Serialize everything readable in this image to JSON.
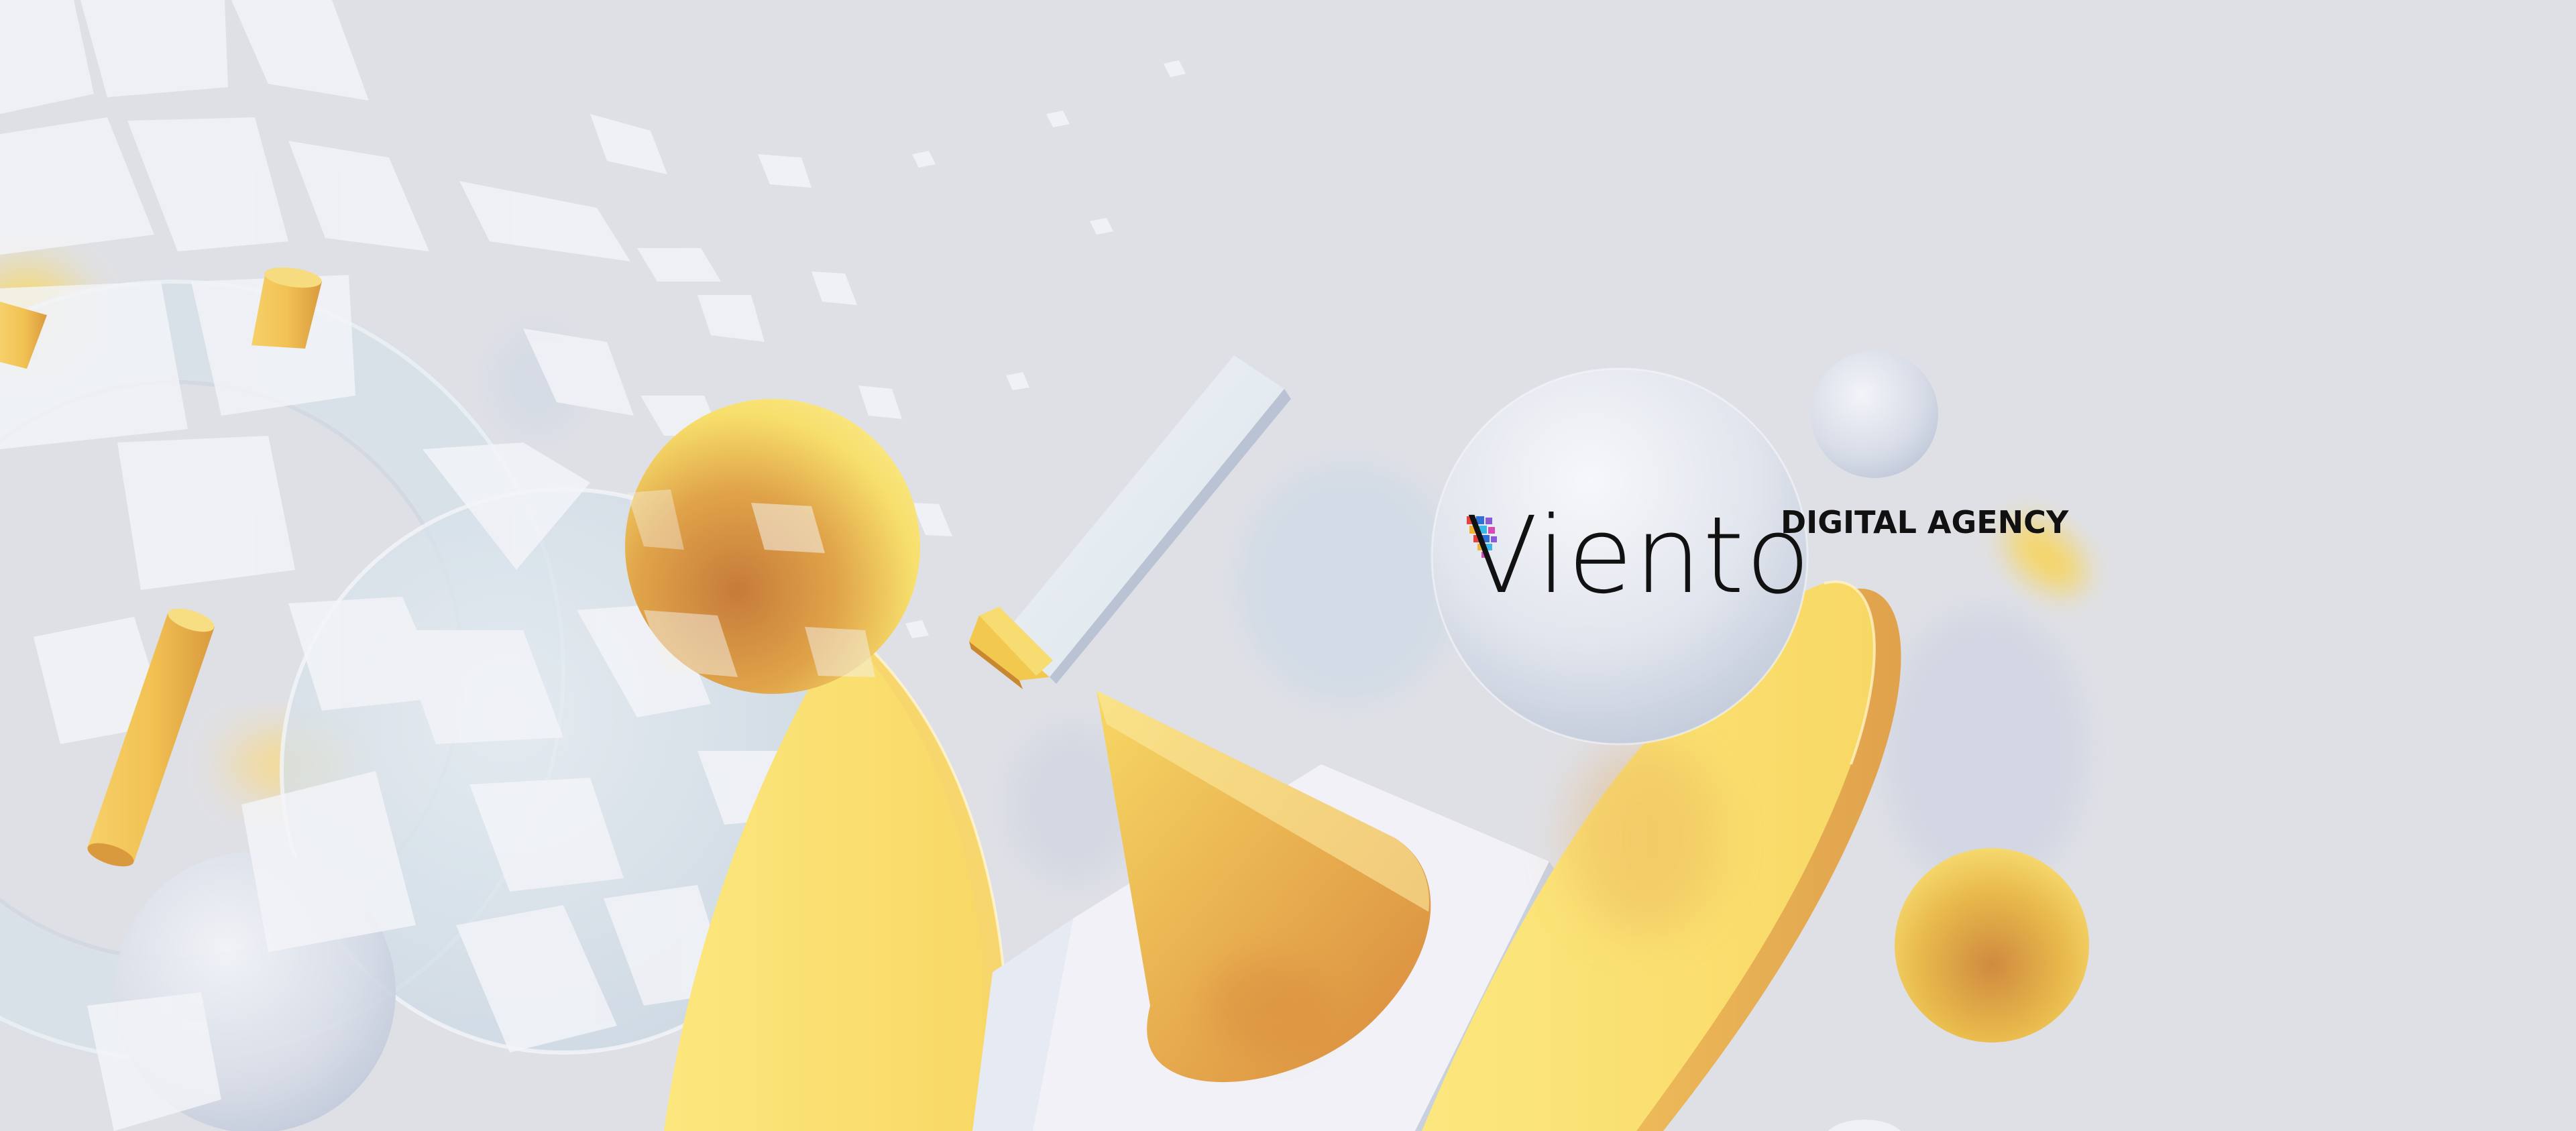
{
  "logo": {
    "wordmark": "Viento",
    "tagline": "DIGITAL AGENCY",
    "mosaic_colors": [
      "#e8403a",
      "#2f6fd6",
      "#8a5bd6",
      "#f2b531",
      "#38b7e8",
      "#d94ab4"
    ]
  },
  "palette": {
    "background": "#dfe0e6",
    "yellow_light": "#fbe57a",
    "yellow_deep": "#e0a148",
    "silver": "#c9d0de",
    "ice": "#dbe6ee",
    "ink": "#111111"
  }
}
